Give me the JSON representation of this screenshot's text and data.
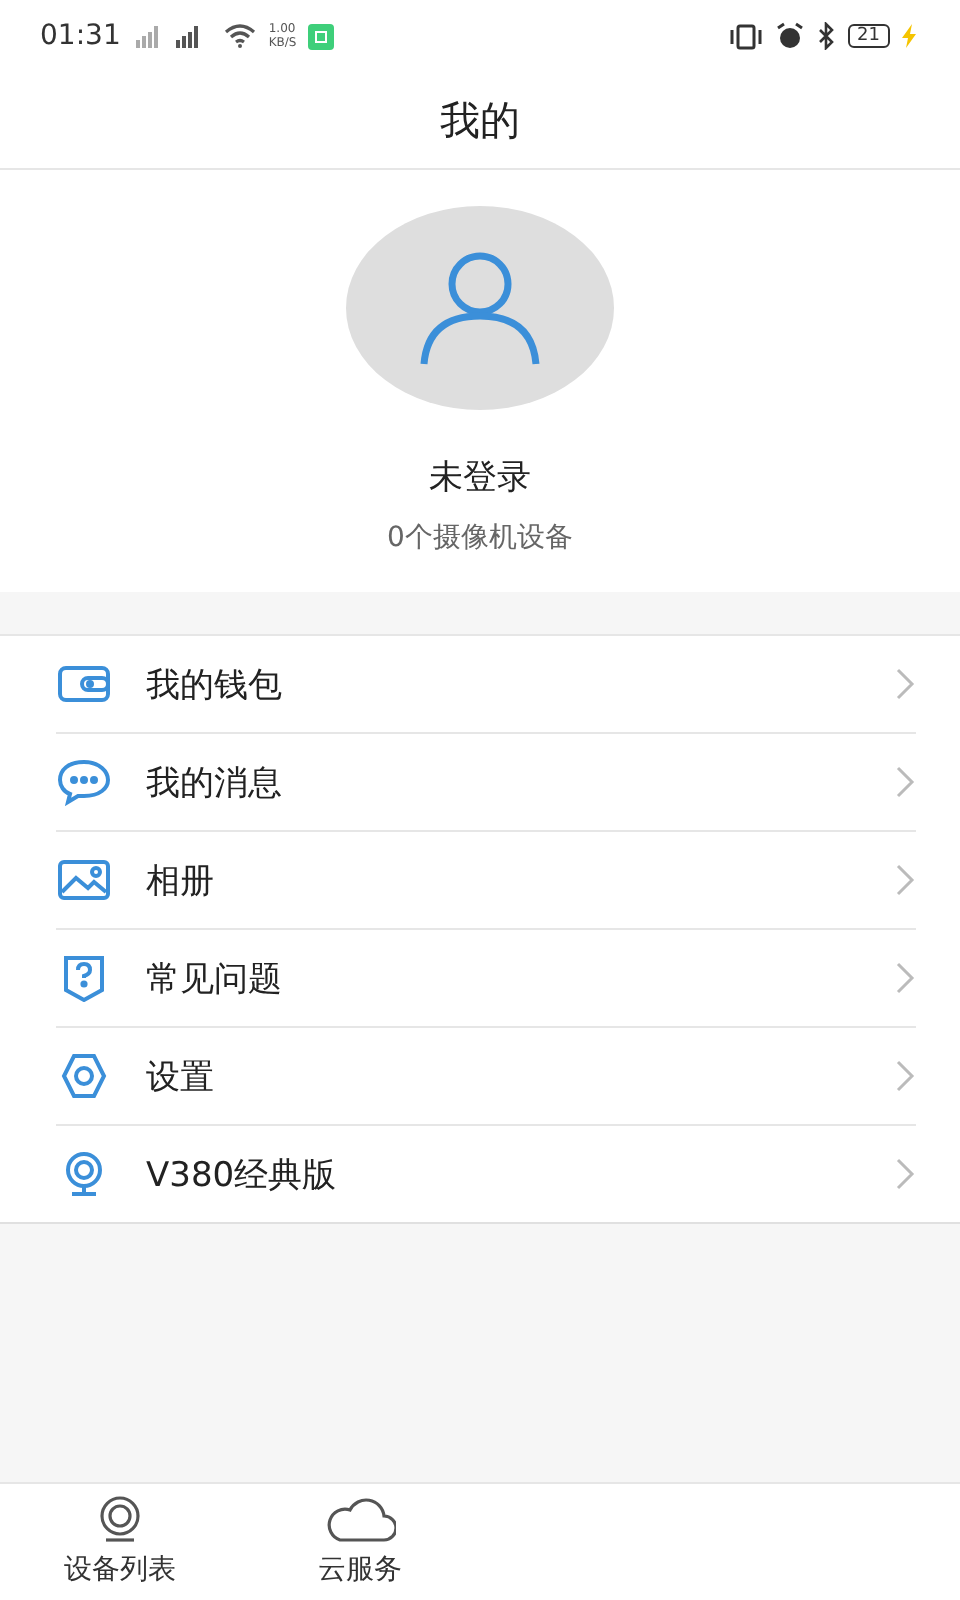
{
  "status_bar": {
    "time": "01:31",
    "speed": "1.00",
    "speed_unit": "KB/S",
    "battery": "21"
  },
  "header": {
    "title": "我的"
  },
  "profile": {
    "name": "未登录",
    "subtitle": "0个摄像机设备"
  },
  "menu": [
    {
      "kind": "wallet",
      "label": "我的钱包"
    },
    {
      "kind": "message",
      "label": "我的消息"
    },
    {
      "kind": "album",
      "label": "相册"
    },
    {
      "kind": "help",
      "label": "常见问题"
    },
    {
      "kind": "settings",
      "label": "设置"
    },
    {
      "kind": "camera",
      "label": "V380经典版"
    }
  ],
  "bottom_nav": [
    {
      "kind": "camera",
      "label": "设备列表"
    },
    {
      "kind": "cloud",
      "label": "云服务"
    }
  ]
}
